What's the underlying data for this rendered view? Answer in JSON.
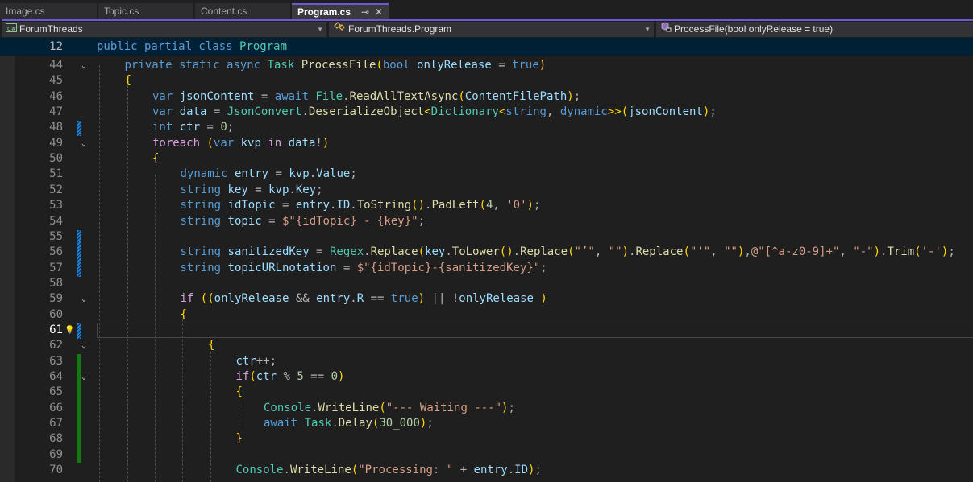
{
  "tabs": [
    {
      "label": "Image.cs",
      "active": false
    },
    {
      "label": "Topic.cs",
      "active": false
    },
    {
      "label": "Content.cs",
      "active": false
    },
    {
      "label": "Program.cs",
      "active": true
    }
  ],
  "tab_icons": {
    "pin": "⊸",
    "close": "✕"
  },
  "navbar": {
    "project": "ForumThreads",
    "project_icon": "csharp-project-icon",
    "type": "ForumThreads.Program",
    "type_icon": "class-icon",
    "member": "ProcessFile(bool onlyRelease = true)",
    "member_icon": "private-method-icon"
  },
  "sticky_scroll": {
    "line_number": "12",
    "code": "public partial class Program"
  },
  "lines": [
    {
      "n": "44",
      "code": "private static async Task ProcessFile(bool onlyRelease = true)"
    },
    {
      "n": "45",
      "code": "{"
    },
    {
      "n": "46",
      "code": "var jsonContent = await File.ReadAllTextAsync(ContentFilePath);"
    },
    {
      "n": "47",
      "code": "var data = JsonConvert.DeserializeObject<Dictionary<string, dynamic>>(jsonContent);"
    },
    {
      "n": "48",
      "code": "int ctr = 0;"
    },
    {
      "n": "49",
      "code": "foreach (var kvp in data!)"
    },
    {
      "n": "50",
      "code": "{"
    },
    {
      "n": "51",
      "code": "dynamic entry = kvp.Value;"
    },
    {
      "n": "52",
      "code": "string key = kvp.Key;"
    },
    {
      "n": "53",
      "code": "string idTopic = entry.ID.ToString().PadLeft(4, '0');"
    },
    {
      "n": "54",
      "code": "string topic = $\"{idTopic} - {key}\";"
    },
    {
      "n": "55",
      "code": ""
    },
    {
      "n": "56",
      "code": "string sanitizedKey = Regex.Replace(key.ToLower().Replace(\"’\", \"\").Replace(\"'\", \"\"),@\"[^a-z0-9]+\", \"-\").Trim('-');"
    },
    {
      "n": "57",
      "code": "string topicURLnotation = $\"{idTopic}-{sanitizedKey}\";"
    },
    {
      "n": "58",
      "code": ""
    },
    {
      "n": "59",
      "code": "if ((onlyRelease && entry.R == true) || !onlyRelease )"
    },
    {
      "n": "60",
      "code": "{"
    },
    {
      "n": "61",
      "code": ""
    },
    {
      "n": "62",
      "code": "{"
    },
    {
      "n": "63",
      "code": "ctr++;"
    },
    {
      "n": "64",
      "code": "if(ctr % 5 == 0)"
    },
    {
      "n": "65",
      "code": "{"
    },
    {
      "n": "66",
      "code": "Console.WriteLine(\"--- Waiting ---\");"
    },
    {
      "n": "67",
      "code": "await Task.Delay(30_000);"
    },
    {
      "n": "68",
      "code": "}"
    },
    {
      "n": "69",
      "code": ""
    },
    {
      "n": "70",
      "code": "Console.WriteLine(\"Processing: \" + entry.ID);"
    }
  ],
  "current_line": "61",
  "colors": {
    "accent": "#6e58d6",
    "editor_bg": "#1f1f1f",
    "sticky_bg": "#002036",
    "change_saved": "#107c10",
    "change_unsaved": "#1a7fd6"
  }
}
